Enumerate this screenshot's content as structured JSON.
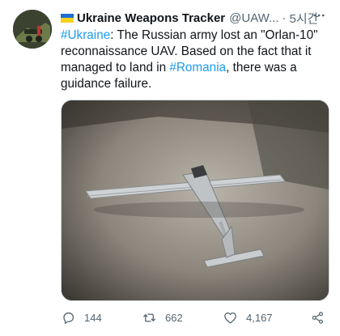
{
  "author": {
    "display_name": "Ukraine Weapons Tracker",
    "handle": "@UAW...",
    "separator": "·",
    "time": "5시간"
  },
  "tweet": {
    "hashtag_1": "#Ukraine",
    "text_1": ": The Russian army lost an \"Orlan-10\" reconnaissance UAV. Based on the fact that it managed to land in ",
    "hashtag_2": "#Romania",
    "text_2": ", there was a guidance failure."
  },
  "media": {
    "subject": "grounded Orlan-10 drone on concrete at night"
  },
  "actions": {
    "replies": "144",
    "retweets": "662",
    "likes": "4,167"
  },
  "icons": {
    "more": "more-icon",
    "reply": "reply-icon",
    "retweet": "retweet-icon",
    "like": "like-icon",
    "share": "share-icon"
  },
  "colors": {
    "link": "#1d9bf0",
    "secondary_text": "#536471",
    "primary_text": "#0f1419"
  }
}
